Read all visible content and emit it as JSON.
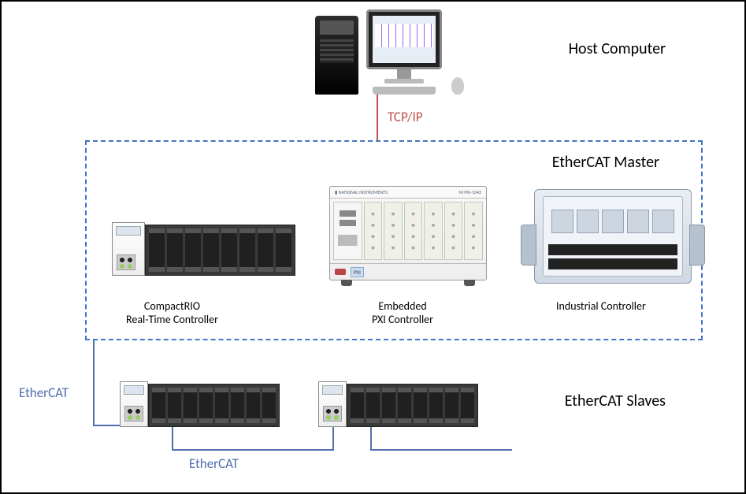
{
  "host": {
    "label": "Host Computer"
  },
  "connections": {
    "host_to_master": "TCP/IP",
    "master_to_slave": "EtherCAT",
    "slave_to_slave": "EtherCAT"
  },
  "master": {
    "title": "EtherCAT Master",
    "devices": [
      {
        "id": "compactrio",
        "label": "CompactRIO\nReal-Time Controller"
      },
      {
        "id": "pxi",
        "label": "Embedded\nPXI Controller"
      },
      {
        "id": "industrial",
        "label": "Industrial Controller"
      }
    ]
  },
  "slaves": {
    "title": "EtherCAT Slaves"
  },
  "icons": {
    "desktop": "desktop-pc-icon",
    "crio": "compactrio-chassis-icon",
    "pxi": "pxi-chassis-icon",
    "indc": "industrial-controller-icon"
  }
}
